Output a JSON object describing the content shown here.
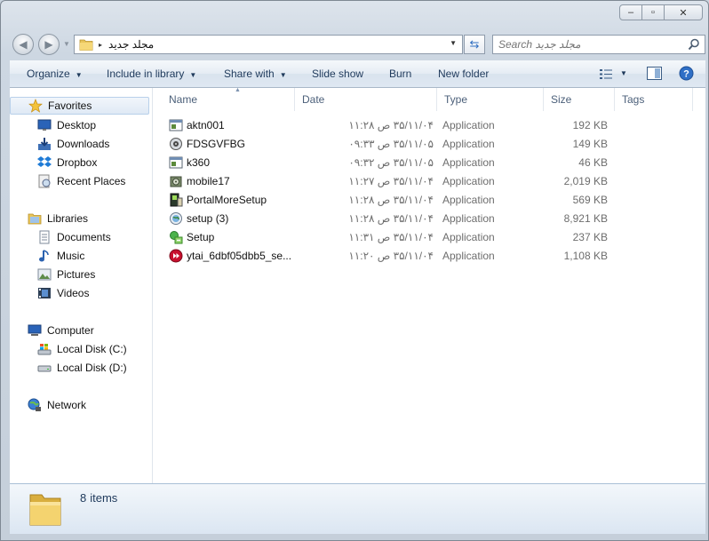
{
  "window": {
    "minimize_glyph": "‒",
    "maximize_glyph": "▫",
    "close_glyph": "✕"
  },
  "address": {
    "path": "مجلد جديد",
    "separator": "▸"
  },
  "search": {
    "placeholder": "Search مجلد جديد"
  },
  "toolbar": {
    "organize": "Organize",
    "include_in_library": "Include in library",
    "share_with": "Share with",
    "slide_show": "Slide show",
    "burn": "Burn",
    "new_folder": "New folder"
  },
  "sidebar": {
    "favorites": "Favorites",
    "favorites_items": [
      {
        "label": "Desktop",
        "icon": "desktop-icon"
      },
      {
        "label": "Downloads",
        "icon": "downloads-icon"
      },
      {
        "label": "Dropbox",
        "icon": "dropbox-icon"
      },
      {
        "label": "Recent Places",
        "icon": "recent-places-icon"
      }
    ],
    "libraries": "Libraries",
    "libraries_items": [
      {
        "label": "Documents",
        "icon": "documents-icon"
      },
      {
        "label": "Music",
        "icon": "music-icon"
      },
      {
        "label": "Pictures",
        "icon": "pictures-icon"
      },
      {
        "label": "Videos",
        "icon": "videos-icon"
      }
    ],
    "computer": "Computer",
    "computer_items": [
      {
        "label": "Local Disk (C:)",
        "icon": "system-disk-icon"
      },
      {
        "label": "Local Disk (D:)",
        "icon": "disk-icon"
      }
    ],
    "network": "Network"
  },
  "columns": {
    "name": "Name",
    "date": "Date",
    "type": "Type",
    "size": "Size",
    "tags": "Tags"
  },
  "files": [
    {
      "name": "aktn001",
      "date": "۳۵/۱۱/۰۴ ص ۱۱:۲۸",
      "type": "Application",
      "size": "192 KB",
      "icon": "app-window-icon"
    },
    {
      "name": "FDSGVFBG",
      "date": "۳۵/۱۱/۰۵ ص ۰۹:۳۳",
      "type": "Application",
      "size": "149 KB",
      "icon": "speaker-app-icon"
    },
    {
      "name": "k360",
      "date": "۳۵/۱۱/۰۵ ص ۰۹:۳۲",
      "type": "Application",
      "size": "46 KB",
      "icon": "app-window-icon"
    },
    {
      "name": "mobile17",
      "date": "۳۵/۱۱/۰۴ ص ۱۱:۲۷",
      "type": "Application",
      "size": "2,019 KB",
      "icon": "installer-icon"
    },
    {
      "name": "PortalMoreSetup",
      "date": "۳۵/۱۱/۰۴ ص ۱۱:۲۸",
      "type": "Application",
      "size": "569 KB",
      "icon": "setup-box-icon"
    },
    {
      "name": "setup (3)",
      "date": "۳۵/۱۱/۰۴ ص ۱۱:۲۸",
      "type": "Application",
      "size": "8,921 KB",
      "icon": "globe-setup-icon"
    },
    {
      "name": "Setup",
      "date": "۳۵/۱۱/۰۴ ص ۱۱:۳۱",
      "type": "Application",
      "size": "237 KB",
      "icon": "green-setup-icon"
    },
    {
      "name": "ytai_6dbf05dbb5_se...",
      "date": "۳۵/۱۱/۰۴ ص ۱۱:۲۰",
      "type": "Application",
      "size": "1,108 KB",
      "icon": "red-play-icon"
    }
  ],
  "status": {
    "count": "8",
    "label": "items"
  },
  "colors": {
    "toolbar_text": "#1e395b",
    "header_text": "#4c607a",
    "secondary_text": "#6d6d6d",
    "selection_border": "#b8d0ea"
  }
}
